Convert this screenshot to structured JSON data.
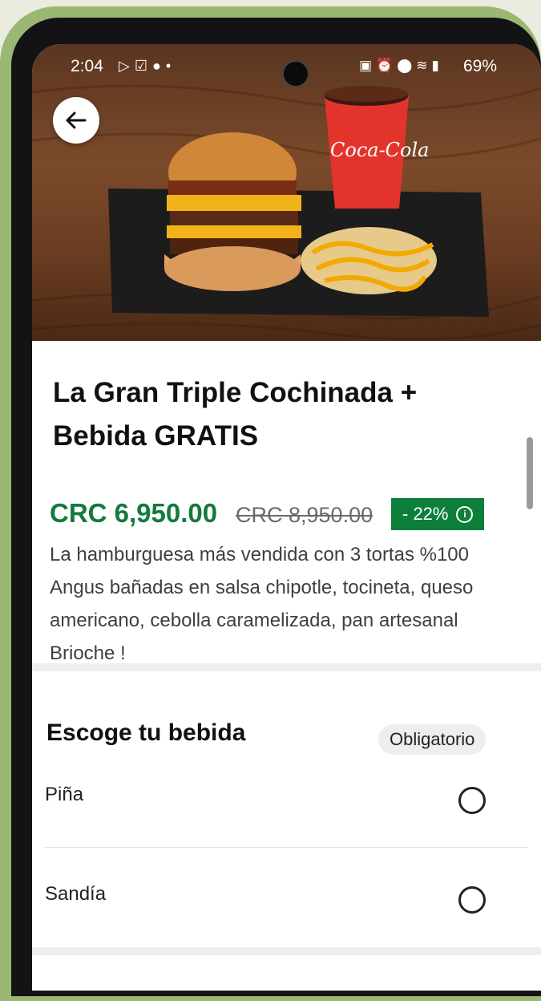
{
  "status_bar": {
    "time": "2:04",
    "left_icons": [
      "play-store-icon",
      "checkbox-icon",
      "chat-icon",
      "dot-icon"
    ],
    "right_icons": [
      "clipboard-icon",
      "alarm-icon",
      "location-icon",
      "wifi-icon",
      "signal-icon"
    ],
    "battery": "69%"
  },
  "hero": {
    "image_label": "food-photo",
    "cup_text": "Coca-Cola"
  },
  "product": {
    "title_line1": "La Gran Triple Cochinada +",
    "title_line2": "Bebida GRATIS",
    "price": "CRC 6,950.00",
    "old_price": "CRC 8,950.00",
    "discount": "- 22%",
    "description": "La hamburguesa más vendida con  3 tortas %100 Angus bañadas en salsa chipotle, tocineta, queso americano, cebolla caramelizada, pan artesanal Brioche !"
  },
  "section": {
    "title": "Escoge tu bebida",
    "badge": "Obligatorio",
    "options": [
      {
        "label": "Piña"
      },
      {
        "label": "Sandía"
      }
    ]
  },
  "colors": {
    "price_green": "#137a3b",
    "badge_green": "#0d7f3b",
    "phone_case": "#9bb873"
  }
}
